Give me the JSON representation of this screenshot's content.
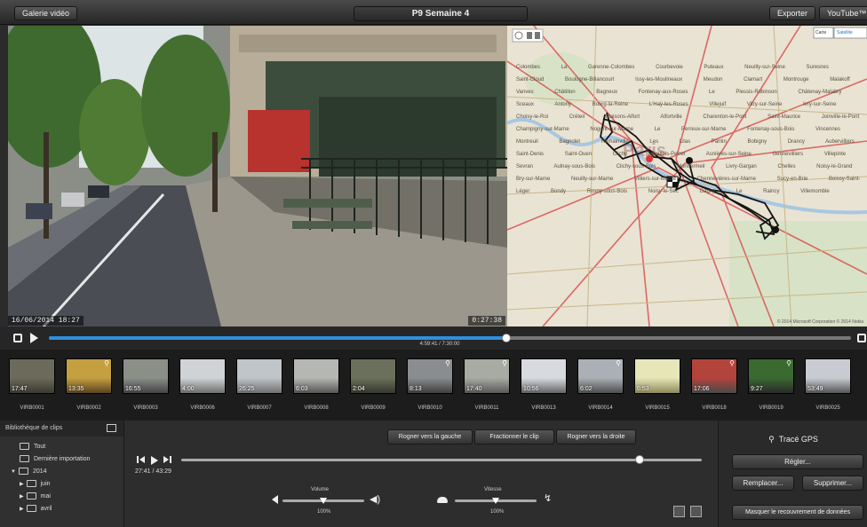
{
  "toolbar": {
    "gallery_label": "Galerie vidéo",
    "project_title": "P9 Semaine 4",
    "export_label": "Exporter",
    "youtube_label": "YouTube™"
  },
  "video": {
    "date_stamp": "16/06/2014 18:27",
    "time_stamp": "0:27:38",
    "time_counter": "4:59:41 / 7:30:00",
    "progress": 0.57
  },
  "map": {
    "view_plan": "Carte",
    "view_satellite": "Satellite",
    "center_label": "Paris",
    "copyright": "© 2014 Microsoft Corporation  © 2014 Nokia",
    "places": [
      "Colombes",
      "La Garenne-Colombes",
      "Courbevoie",
      "Puteaux",
      "Neuilly-sur-Seine",
      "Suresnes",
      "Saint-Cloud",
      "Boulogne-Billancourt",
      "Issy-les-Moulineaux",
      "Meudon",
      "Clamart",
      "Montrouge",
      "Malakoff",
      "Vanves",
      "Châtillon",
      "Bagneux",
      "Fontenay-aux-Roses",
      "Le Plessis-Robinson",
      "Châtenay-Malabry",
      "Sceaux",
      "Antony",
      "Bourg-la-Reine",
      "L'Haÿ-les-Roses",
      "Villejuif",
      "Vitry-sur-Seine",
      "Ivry-sur-Seine",
      "Choisy-le-Roi",
      "Créteil",
      "Maisons-Alfort",
      "Alfortville",
      "Charenton-le-Pont",
      "Saint-Maurice",
      "Joinville-le-Pont",
      "Champigny-sur-Marne",
      "Nogent-sur-Marne",
      "Le Perreux-sur-Marne",
      "Fontenay-sous-Bois",
      "Vincennes",
      "Montreuil",
      "Bagnolet",
      "Romainville",
      "Les Lilas",
      "Pantin",
      "Bobigny",
      "Drancy",
      "Aubervilliers",
      "Saint-Denis",
      "Saint-Ouen",
      "Clichy",
      "Levallois-Perret",
      "Asnières-sur-Seine",
      "Gennevilliers",
      "Villepinte",
      "Sevran",
      "Aulnay-sous-Bois",
      "Clichy-sous-Bois",
      "Montfermeil",
      "Livry-Gargan",
      "Chelles",
      "Noisy-le-Grand",
      "Bry-sur-Marne",
      "Neuilly-sur-Marne",
      "Villiers-sur-Marne",
      "Chennevières-sur-Marne",
      "Sucy-en-Brie",
      "Boissy-Saint-Léger",
      "Bondy",
      "Rosny-sous-Bois",
      "Noisy-le-Sec",
      "Gagny",
      "Le Raincy",
      "Villemomble"
    ]
  },
  "playback_buttons": {
    "stop": "stop",
    "play": "play"
  },
  "clips": [
    {
      "name": "VIRB0001",
      "duration": "17:47",
      "gps": false
    },
    {
      "name": "VIRB0002",
      "duration": "13:35",
      "gps": true
    },
    {
      "name": "VIRB0003",
      "duration": "16:55",
      "gps": false
    },
    {
      "name": "VIRB0006",
      "duration": "4:00",
      "gps": false
    },
    {
      "name": "VIRB0007",
      "duration": "26:25",
      "gps": false
    },
    {
      "name": "VIRB0008",
      "duration": "6:03",
      "gps": false
    },
    {
      "name": "VIRB0009",
      "duration": "2:04",
      "gps": false
    },
    {
      "name": "VIRB0010",
      "duration": "8:13",
      "gps": true
    },
    {
      "name": "VIRB0011",
      "duration": "17:40",
      "gps": true
    },
    {
      "name": "VIRB0013",
      "duration": "10:56",
      "gps": false
    },
    {
      "name": "VIRB0014",
      "duration": "6:02",
      "gps": true
    },
    {
      "name": "VIRB0015",
      "duration": "6:53",
      "gps": false
    },
    {
      "name": "VIRB0018",
      "duration": "17:06",
      "gps": true
    },
    {
      "name": "VIRB0019",
      "duration": "9:27",
      "gps": true
    },
    {
      "name": "VIRB0025",
      "duration": "53:49",
      "gps": false
    }
  ],
  "library": {
    "title": "Bibliothèque de clips",
    "items": [
      "Tout",
      "Dernière importation",
      "2014",
      "juin",
      "mai",
      "avril"
    ]
  },
  "editor": {
    "trim_left": "Rogner vers la gauche",
    "split_clip": "Fractionner le clip",
    "trim_right": "Rogner vers la droite",
    "clip_time": "27:41 / 43:29",
    "clip_position": 0.88,
    "volume_label": "Volume",
    "volume_value": "100%",
    "volume_level": 0.5,
    "speed_label": "Vitesse",
    "speed_value": "100%",
    "speed_level": 0.5
  },
  "gps_panel": {
    "title": "Tracé GPS",
    "adjust_label": "Régler...",
    "replace_label": "Remplacer...",
    "delete_label": "Supprimer...",
    "hide_overlay_label": "Masquer le recouvrement de données"
  },
  "colors": {
    "accent_blue": "#2f8fe0",
    "map_road_red": "#d84a4a",
    "map_background": "#e9e3d3"
  }
}
